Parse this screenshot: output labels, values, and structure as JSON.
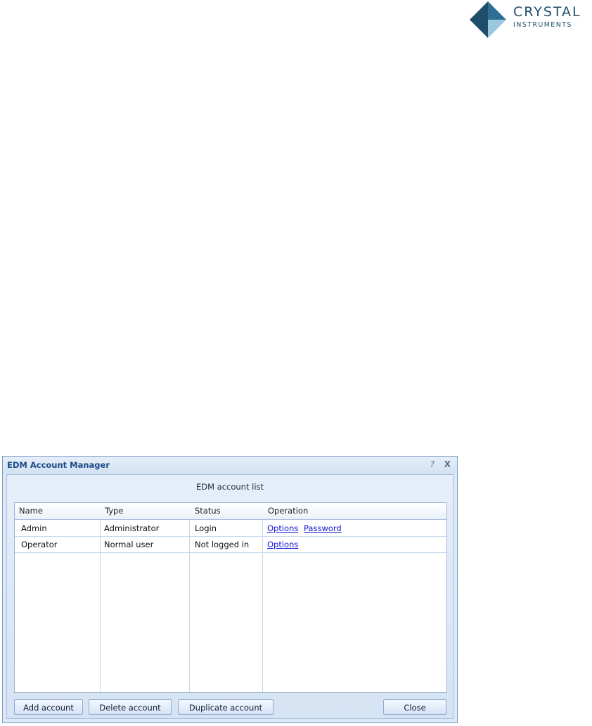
{
  "logo": {
    "line1": "CRYSTAL",
    "line2": "INSTRUMENTS"
  },
  "dialog": {
    "title": "EDM Account Manager",
    "help_glyph": "?",
    "close_glyph": "X",
    "list_caption": "EDM account list",
    "columns": [
      "Name",
      "Type",
      "Status",
      "Operation"
    ],
    "rows": [
      {
        "name": "Admin",
        "type": "Administrator",
        "status": "Login",
        "links": [
          "Options",
          "Password"
        ]
      },
      {
        "name": "Operator",
        "type": "Normal user",
        "status": "Not logged in",
        "links": [
          "Options"
        ]
      }
    ],
    "buttons": {
      "add": "Add account",
      "delete": "Delete account",
      "duplicate": "Duplicate account",
      "close": "Close"
    }
  },
  "colors": {
    "brand_dark": "#1f4e6b",
    "brand_light": "#8fc3dc",
    "link": "#1414d2",
    "title": "#1b4a86"
  }
}
